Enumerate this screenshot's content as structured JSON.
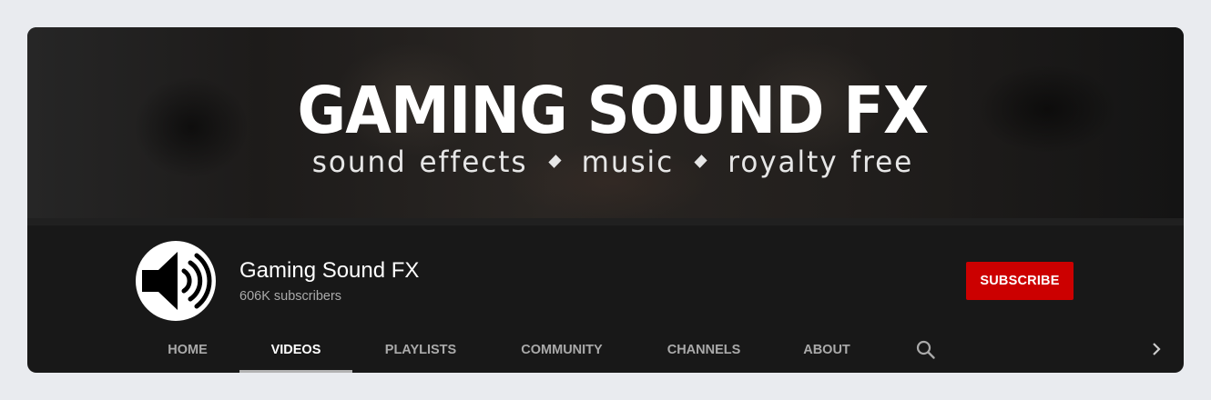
{
  "banner": {
    "title": "GAMING SOUND FX",
    "tagline": [
      "sound effects",
      "music",
      "royalty free"
    ]
  },
  "channel": {
    "name": "Gaming Sound FX",
    "subscribers": "606K subscribers",
    "avatar_icon": "speaker-icon"
  },
  "subscribe_button": {
    "label": "SUBSCRIBE",
    "color": "#cc0000"
  },
  "tabs": [
    {
      "label": "HOME",
      "active": false
    },
    {
      "label": "VIDEOS",
      "active": true
    },
    {
      "label": "PLAYLISTS",
      "active": false
    },
    {
      "label": "COMMUNITY",
      "active": false
    },
    {
      "label": "CHANNELS",
      "active": false
    },
    {
      "label": "ABOUT",
      "active": false
    }
  ],
  "icons": {
    "search": "search-icon",
    "next": "chevron-right-icon"
  }
}
